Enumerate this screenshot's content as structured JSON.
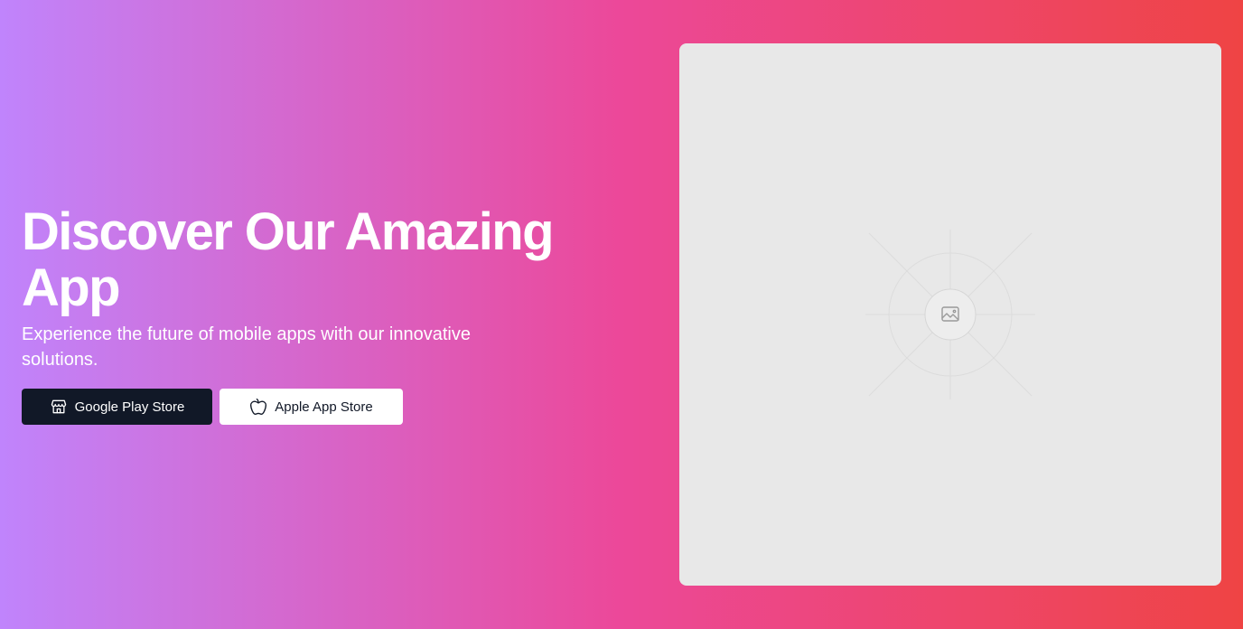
{
  "hero": {
    "title": "Discover Our Amazing App",
    "subtitle": "Experience the future of mobile apps with our innovative solutions."
  },
  "buttons": {
    "google_play": {
      "label": "Google Play Store",
      "icon": "store-icon"
    },
    "app_store": {
      "label": "Apple App Store",
      "icon": "apple-icon"
    }
  },
  "image_placeholder": {
    "icon": "image-icon"
  },
  "colors": {
    "gradient_start": "#c084fc",
    "gradient_mid": "#ec4899",
    "gradient_end": "#ef4444",
    "dark_button": "#111827",
    "light_button": "#ffffff",
    "placeholder_bg": "#e8e8e8"
  }
}
